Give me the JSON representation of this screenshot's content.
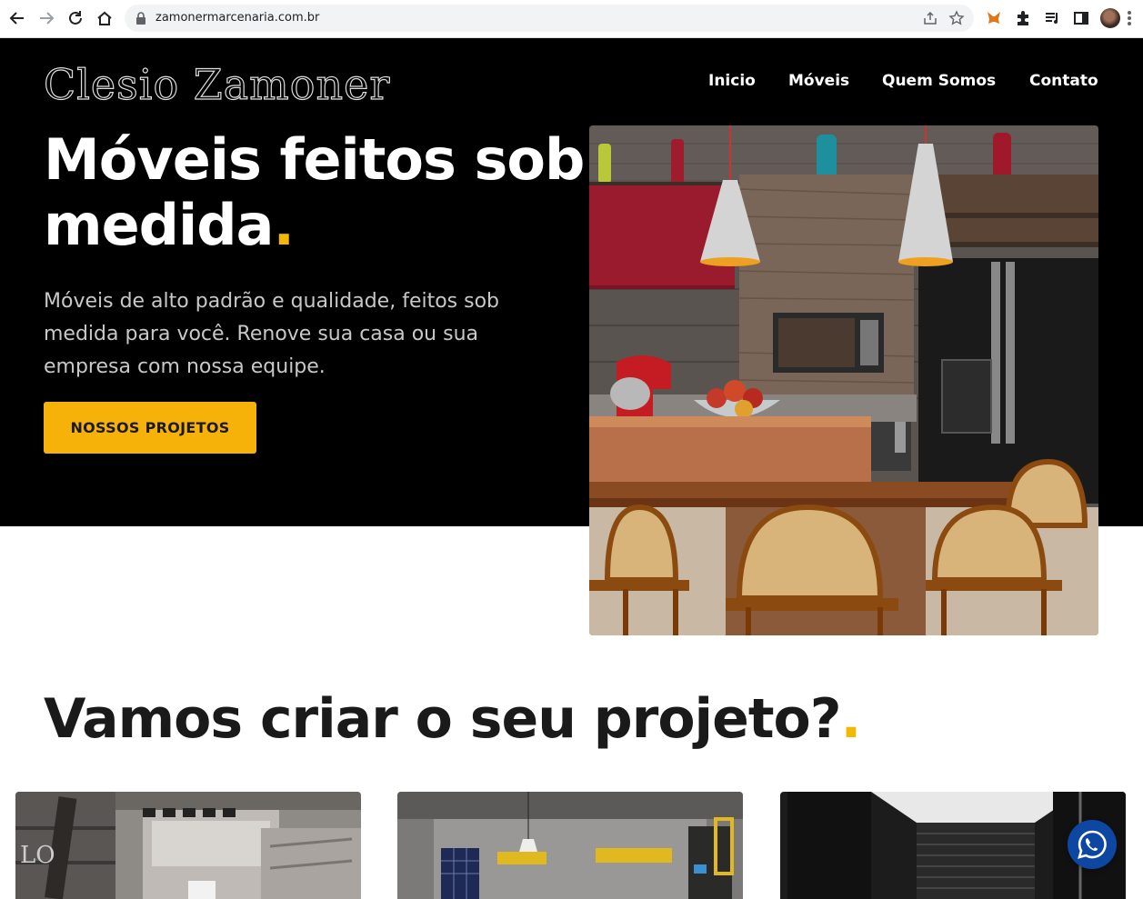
{
  "browser": {
    "url": "zamonermarcenaria.com.br"
  },
  "header": {
    "logo": "Clesio Zamoner",
    "nav": [
      {
        "label": "Inicio"
      },
      {
        "label": "Móveis"
      },
      {
        "label": "Quem Somos"
      },
      {
        "label": "Contato"
      }
    ]
  },
  "hero": {
    "title_line1": "Móveis feitos sob",
    "title_line2": "medida",
    "title_dot": ".",
    "description": "Móveis de alto padrão e qualidade, feitos sob medida para você. Renove sua casa ou sua empresa com nossa equipe.",
    "cta_label": "NOSSOS PROJETOS"
  },
  "projects": {
    "title": "Vamos criar o seu projeto?",
    "title_dot": "."
  },
  "colors": {
    "accent": "#f7b20a",
    "hero_bg": "#000000",
    "whatsapp_bg": "#0d47a1"
  }
}
